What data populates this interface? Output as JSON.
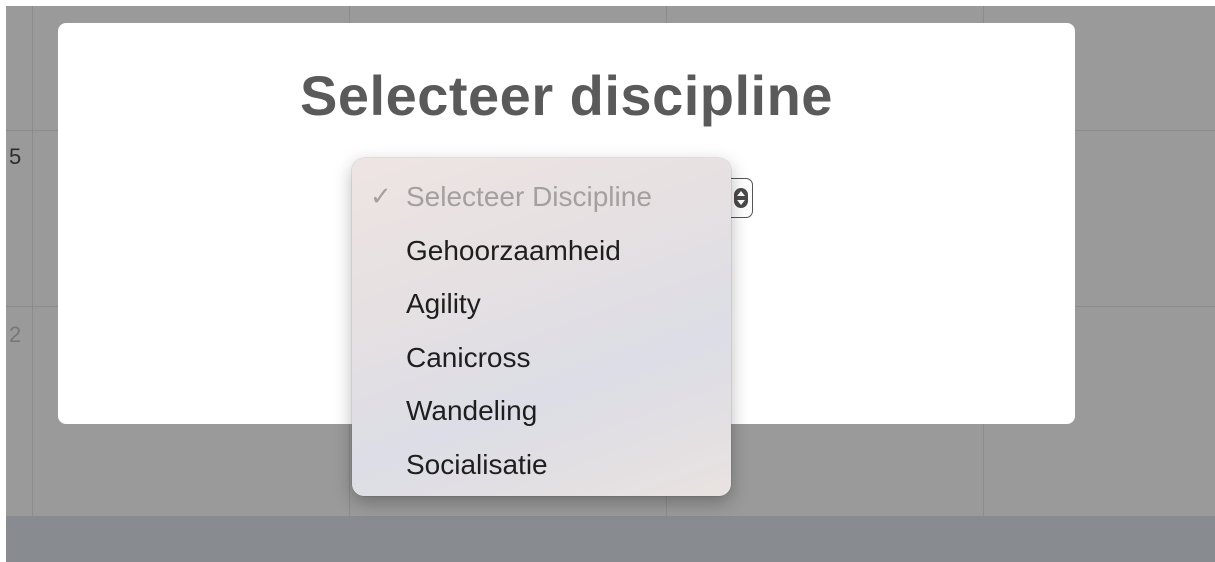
{
  "calendar": {
    "day_numbers": [
      "5",
      "2"
    ]
  },
  "modal": {
    "title": "Selecteer discipline"
  },
  "dropdown": {
    "selected_mark": "✓",
    "items": [
      {
        "label": "Selecteer Discipline",
        "disabled": true,
        "selected": true
      },
      {
        "label": "Gehoorzaamheid",
        "disabled": false,
        "selected": false
      },
      {
        "label": "Agility",
        "disabled": false,
        "selected": false
      },
      {
        "label": "Canicross",
        "disabled": false,
        "selected": false
      },
      {
        "label": "Wandeling",
        "disabled": false,
        "selected": false
      },
      {
        "label": "Socialisatie",
        "disabled": false,
        "selected": false
      }
    ]
  },
  "icons": {
    "select_arrows": "updown-chevron-icon",
    "check": "checkmark-icon"
  },
  "colors": {
    "overlay": "#9a9a9a",
    "modal_bg": "#ffffff",
    "title": "#5a5a5a",
    "menu_text": "#1e1e1e",
    "menu_disabled": "#a4a0a0"
  }
}
